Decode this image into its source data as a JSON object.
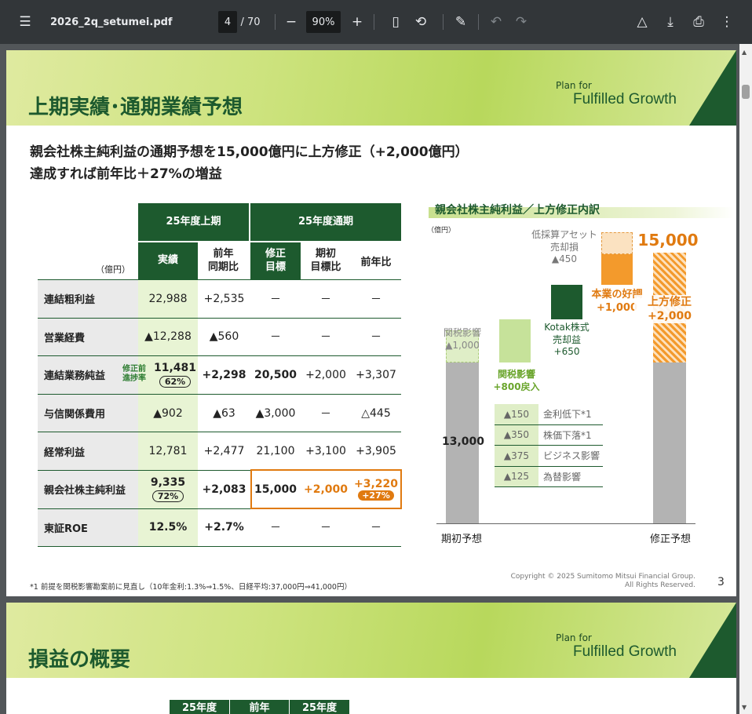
{
  "toolbar": {
    "title": "2026_2q_setumei.pdf",
    "page_current": "4",
    "page_total": "/ 70",
    "zoom": "90%"
  },
  "page1": {
    "brand_line1": "Plan for",
    "brand_line2": "Fulfilled Growth",
    "title": "上期実績･通期業績予想",
    "headline1": "親会社株主純利益の通期予想を15,000億円に上方修正（+2,000億円）",
    "headline2": "達成すれば前年比＋27%の増益",
    "table": {
      "unit": "（億円）",
      "group1": "25年度上期",
      "group2": "25年度通期",
      "col1": "実績",
      "col2": "前年\n同期比",
      "col3": "修正\n目標",
      "col4": "期初\n目標比",
      "col5": "前年比",
      "rows": [
        {
          "label": "連結粗利益",
          "c1": "22,988",
          "c2": "+2,535",
          "c3": "－",
          "c4": "－",
          "c5": "－"
        },
        {
          "label": "営業経費",
          "c1": "▲12,288",
          "c2": "▲560",
          "c3": "－",
          "c4": "－",
          "c5": "－"
        },
        {
          "label": "連結業務純益",
          "c1": "11,481",
          "c1b": "62%",
          "note": "修正前\n進捗率",
          "c2": "+2,298",
          "c3": "20,500",
          "c4": "+2,000",
          "c5": "+3,307"
        },
        {
          "label": "与信関係費用",
          "c1": "▲902",
          "c2": "▲63",
          "c3": "▲3,000",
          "c4": "－",
          "c5": "△445"
        },
        {
          "label": "経常利益",
          "c1": "12,781",
          "c2": "+2,477",
          "c3": "21,100",
          "c4": "+3,100",
          "c5": "+3,905"
        },
        {
          "label": "親会社株主純利益",
          "c1": "9,335",
          "c1b": "72%",
          "c2": "+2,083",
          "c3": "15,000",
          "c4": "+2,000",
          "c5": "+3,220",
          "c5b": "+27%"
        },
        {
          "label": "東証ROE",
          "c1": "12.5%",
          "c2": "+2.7%",
          "c3": "－",
          "c4": "－",
          "c5": "－"
        }
      ]
    },
    "chart": {
      "title": "親会社株主純利益／上方修正内訳",
      "unit": "（億円）",
      "base_label": "13,000",
      "start_label": "期初予想",
      "end_label": "修正予想",
      "tariff_left": "関税影響\n▲1,000",
      "tariff_back": "関税影響\n+800戻入",
      "kotak": "Kotak株式\n売却益\n+650",
      "hondo": "本業の好調\n+1,000",
      "lowprofit": "低採算アセット\n売却損\n▲450",
      "final": "15,000",
      "upward": "上方修正\n+2,000",
      "breakdown": [
        {
          "v": "▲150",
          "t": "金利低下*1"
        },
        {
          "v": "▲350",
          "t": "株価下落*1"
        },
        {
          "v": "▲375",
          "t": "ビジネス影響"
        },
        {
          "v": "▲125",
          "t": "為替影響"
        }
      ]
    },
    "footnote": "*1 前提を関税影響勘案前に見直し（10年金利:1.3%⇒1.5%、日経平均:37,000円⇒41,000円）",
    "copyright1": "Copyright © 2025 Sumitomo Mitsui Financial Group.",
    "copyright2": "All Rights Reserved.",
    "page_number": "3"
  },
  "page2": {
    "title": "損益の概要",
    "brand_line1": "Plan for",
    "brand_line2": "Fulfilled Growth",
    "col1": "25年度",
    "col2": "前年",
    "col3": "25年度"
  }
}
